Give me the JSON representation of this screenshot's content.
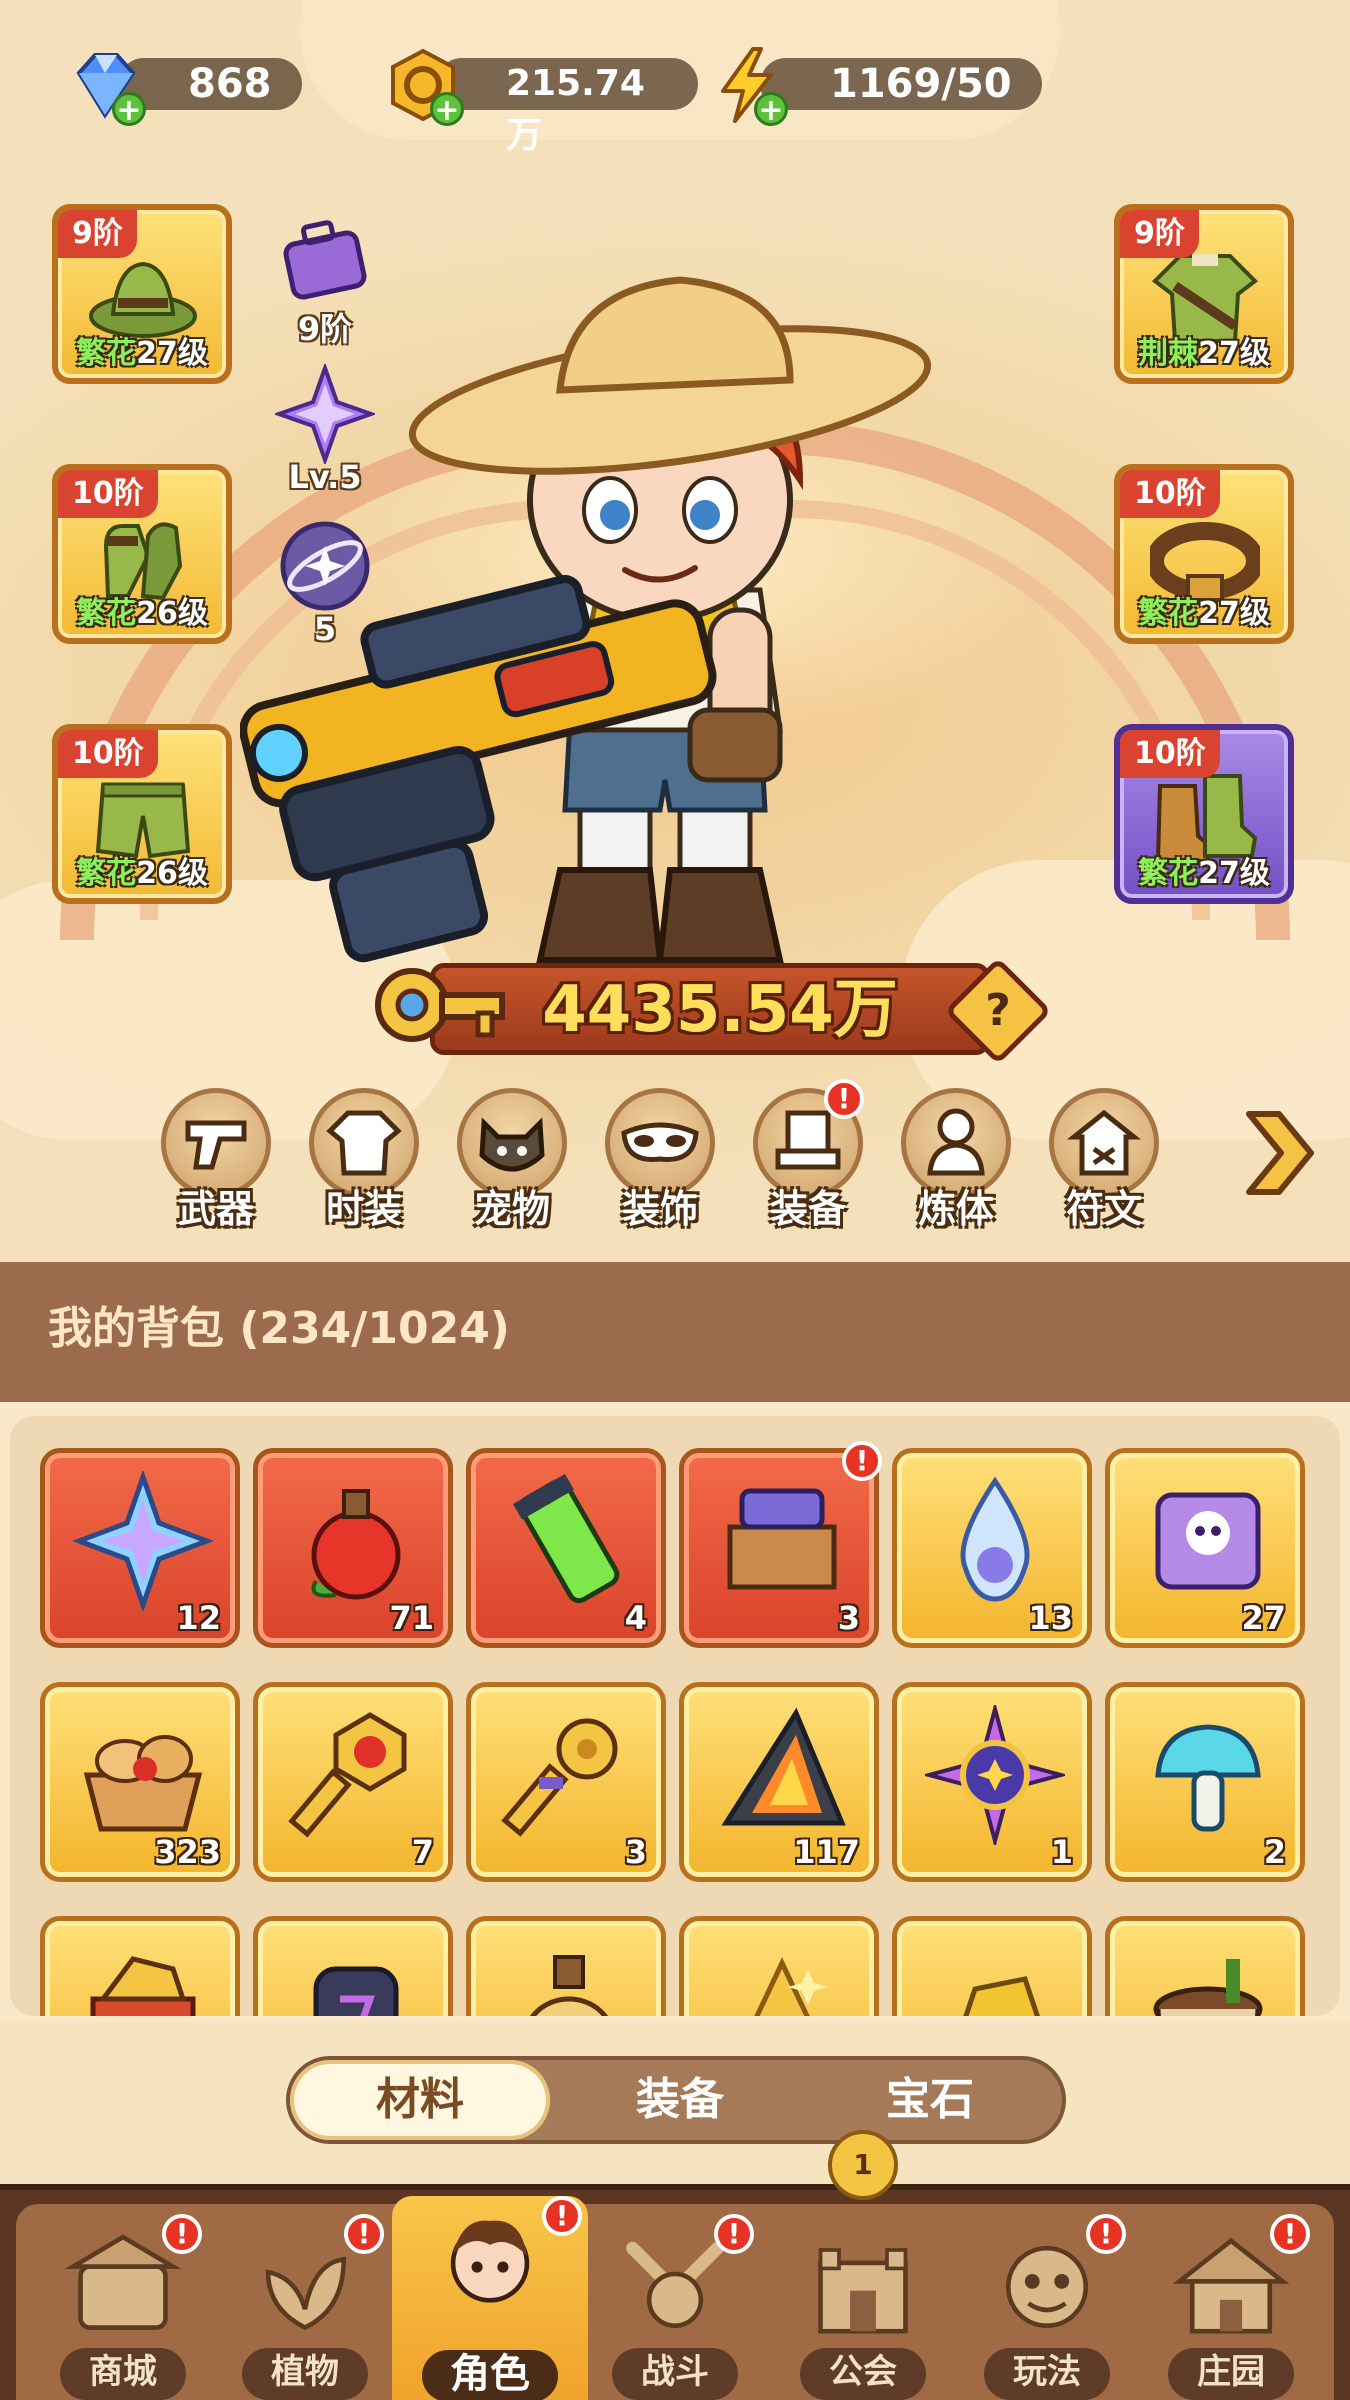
{
  "currency": {
    "diamonds": "868",
    "gold": "215.74万",
    "energy": "1169/50"
  },
  "equipment": {
    "left": [
      {
        "tier": "9阶",
        "set": "繁花",
        "level": "27级",
        "icon": "hat-icon"
      },
      {
        "tier": "10阶",
        "set": "繁花",
        "level": "26级",
        "icon": "gloves-icon"
      },
      {
        "tier": "10阶",
        "set": "繁花",
        "level": "26级",
        "icon": "pants-icon"
      }
    ],
    "right": [
      {
        "tier": "9阶",
        "set": "荆棘",
        "level": "27级",
        "icon": "shirt-icon"
      },
      {
        "tier": "10阶",
        "set": "繁花",
        "level": "27级",
        "icon": "belt-icon"
      },
      {
        "tier": "10阶",
        "set": "繁花",
        "level": "27级",
        "icon": "boots-icon"
      }
    ]
  },
  "side_items": [
    {
      "label": "9阶",
      "icon": "briefcase-icon"
    },
    {
      "label": "Lv.5",
      "icon": "star-crystal-icon"
    },
    {
      "label": "5",
      "icon": "orbit-star-icon"
    }
  ],
  "power": {
    "value": "4435.54万",
    "help": "?"
  },
  "categories": [
    {
      "label": "武器",
      "icon": "weapon-icon"
    },
    {
      "label": "时装",
      "icon": "outfit-icon"
    },
    {
      "label": "宠物",
      "icon": "pet-icon"
    },
    {
      "label": "装饰",
      "icon": "mask-icon"
    },
    {
      "label": "装备",
      "icon": "equipment-icon",
      "badge": "!"
    },
    {
      "label": "炼体",
      "icon": "body-training-icon"
    },
    {
      "label": "符文",
      "icon": "rune-icon"
    }
  ],
  "bag": {
    "title": "我的背包 (234/1024)",
    "items": [
      {
        "count": "12",
        "rarity": "red",
        "icon": "star-gem-icon"
      },
      {
        "count": "71",
        "rarity": "red",
        "icon": "apple-potion-icon"
      },
      {
        "count": "4",
        "rarity": "red",
        "icon": "green-vial-icon"
      },
      {
        "count": "3",
        "rarity": "red",
        "icon": "crate-icon",
        "badge": "!"
      },
      {
        "count": "13",
        "rarity": "gold",
        "icon": "water-drop-icon"
      },
      {
        "count": "27",
        "rarity": "gold",
        "icon": "skull-scroll-icon"
      },
      {
        "count": "323",
        "rarity": "gold",
        "icon": "bread-basket-icon"
      },
      {
        "count": "7",
        "rarity": "gold",
        "icon": "red-key-icon"
      },
      {
        "count": "3",
        "rarity": "gold",
        "icon": "gold-key-icon"
      },
      {
        "count": "117",
        "rarity": "gold",
        "icon": "fire-pyramid-icon"
      },
      {
        "count": "1",
        "rarity": "gold",
        "icon": "purple-orb-icon"
      },
      {
        "count": "2",
        "rarity": "gold",
        "icon": "mushroom-icon"
      },
      {
        "count": "",
        "rarity": "gold",
        "icon": "treasure-icon"
      },
      {
        "count": "",
        "rarity": "gold",
        "icon": "rune-stone-icon"
      },
      {
        "count": "",
        "rarity": "gold",
        "icon": "potion-bottle-icon"
      },
      {
        "count": "",
        "rarity": "gold",
        "icon": "gold-pile-icon"
      },
      {
        "count": "",
        "rarity": "gold",
        "icon": "gold-nugget-icon"
      },
      {
        "count": "",
        "rarity": "gold",
        "icon": "pot-icon"
      }
    ]
  },
  "tabs": [
    "材料",
    "装备",
    "宝石"
  ],
  "nav": [
    {
      "label": "商城",
      "icon": "shop-icon",
      "badge": "!"
    },
    {
      "label": "植物",
      "icon": "plant-icon",
      "badge": "!"
    },
    {
      "label": "角色",
      "icon": "character-icon",
      "badge": "!",
      "active": true
    },
    {
      "label": "战斗",
      "icon": "battle-icon",
      "badge": "!"
    },
    {
      "label": "公会",
      "icon": "guild-icon",
      "badge": "1"
    },
    {
      "label": "玩法",
      "icon": "gameplay-icon",
      "badge": "!"
    },
    {
      "label": "庄园",
      "icon": "manor-icon",
      "badge": "!"
    }
  ],
  "colors": {
    "accent_gold": "#f3b52c",
    "badge_red": "#e63324",
    "set_green": "#8ef05a",
    "power_text": "#ffde5b"
  }
}
